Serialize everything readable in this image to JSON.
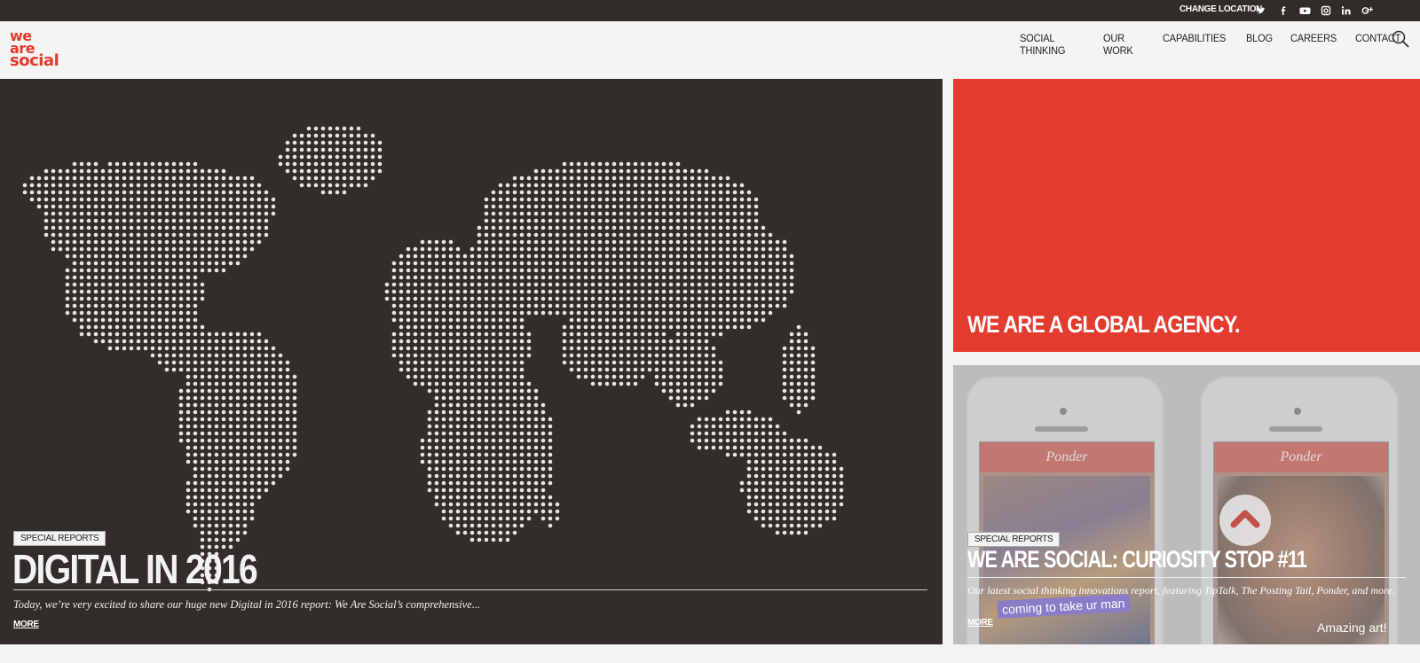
{
  "topbar": {
    "change_location": "CHANGE LOCATION",
    "social": [
      "twitter-icon",
      "facebook-icon",
      "youtube-icon",
      "instagram-icon",
      "linkedin-icon",
      "google-plus-icon"
    ]
  },
  "header": {
    "logo": [
      "we",
      "are",
      "social"
    ],
    "nav": [
      "SOCIAL THINKING",
      "OUR WORK",
      "CAPABILITIES",
      "BLOG",
      "CAREERS",
      "CONTACT"
    ],
    "search_icon": "search-icon"
  },
  "hero": {
    "tag": "SPECIAL REPORTS",
    "title": "DIGITAL IN 2016",
    "excerpt": "Today, we’re very excited to share our huge new Digital in 2016 report: We Are Social’s comprehensive...",
    "more": "MORE"
  },
  "promo": {
    "title": "WE ARE A GLOBAL AGENCY."
  },
  "card": {
    "tag": "SPECIAL REPORTS",
    "title": "WE ARE SOCIAL: CURIOSITY STOP #11",
    "excerpt": "Our latest social thinking innovations report, featuring TipTalk, The Posting Tail, Ponder, and more.",
    "more": "MORE",
    "app_name": "Ponder",
    "caption_left": "coming to take ur man",
    "caption_right": "Amazing art!"
  },
  "colors": {
    "brand_red": "#e43b2f",
    "dark_bg": "#322d2a",
    "topbar_bg": "#302c29"
  }
}
